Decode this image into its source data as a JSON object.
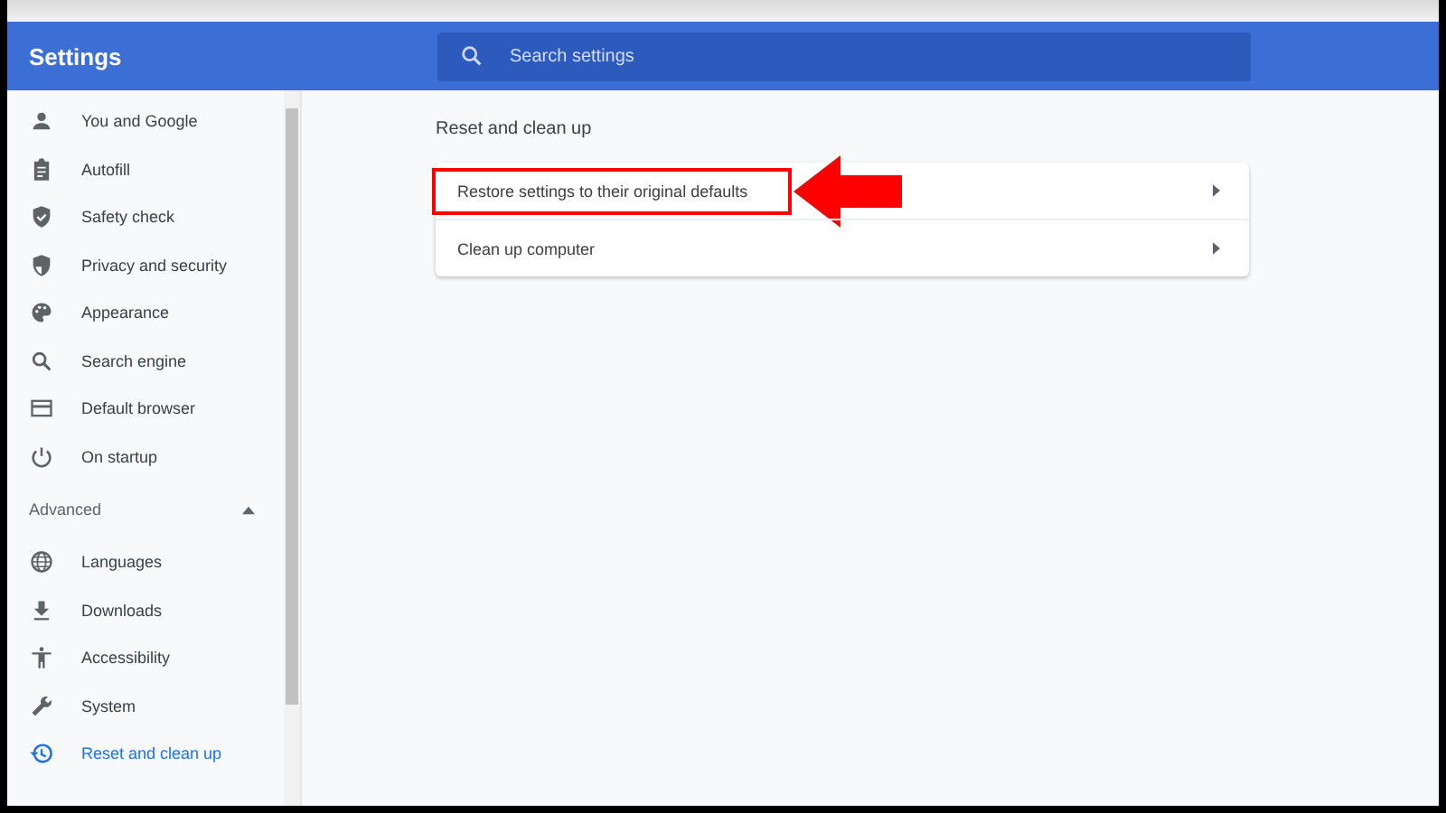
{
  "header": {
    "title": "Settings",
    "search": {
      "placeholder": "Search settings"
    }
  },
  "sidebar": {
    "items": [
      {
        "label": "You and Google",
        "selected": false
      },
      {
        "label": "Autofill",
        "selected": false
      },
      {
        "label": "Safety check",
        "selected": false
      },
      {
        "label": "Privacy and security",
        "selected": false
      },
      {
        "label": "Appearance",
        "selected": false
      },
      {
        "label": "Search engine",
        "selected": false
      },
      {
        "label": "Default browser",
        "selected": false
      },
      {
        "label": "On startup",
        "selected": false
      }
    ],
    "advanced": {
      "label": "Advanced",
      "expanded": true,
      "items": [
        {
          "label": "Languages",
          "selected": false
        },
        {
          "label": "Downloads",
          "selected": false
        },
        {
          "label": "Accessibility",
          "selected": false
        },
        {
          "label": "System",
          "selected": false
        },
        {
          "label": "Reset and clean up",
          "selected": true
        }
      ]
    }
  },
  "content": {
    "section_title": "Reset and clean up",
    "rows": [
      {
        "label": "Restore settings to their original defaults",
        "highlighted": true
      },
      {
        "label": "Clean up computer",
        "highlighted": false
      }
    ]
  }
}
